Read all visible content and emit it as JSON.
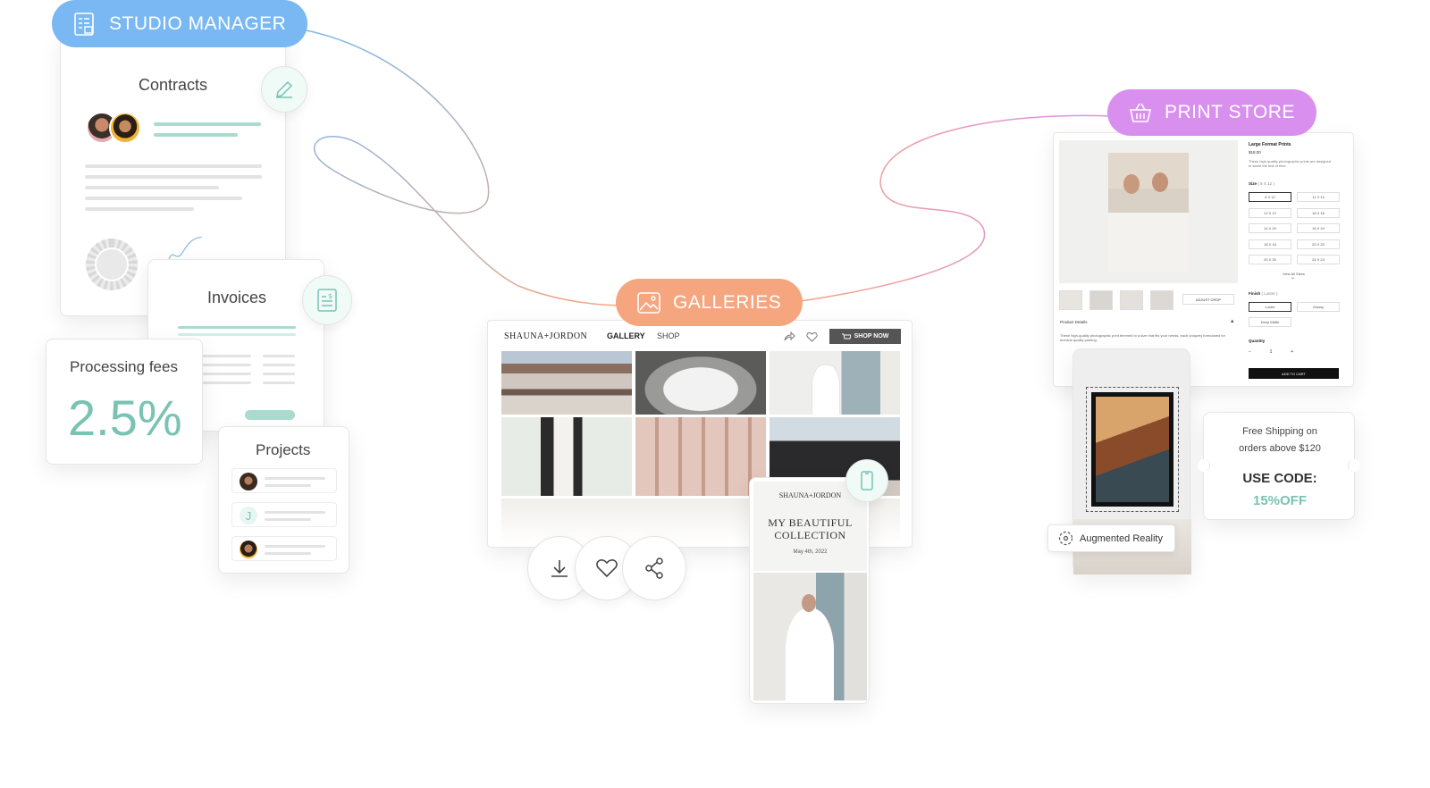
{
  "studio": {
    "label": "STUDIO MANAGER",
    "contracts_title": "Contracts",
    "invoices_title": "Invoices",
    "fees_label": "Processing fees",
    "fees_value": "2.5%",
    "projects_title": "Projects",
    "project_initial": "J"
  },
  "galleries": {
    "label": "GALLERIES",
    "brand": "SHAUNA+JORDON",
    "nav": [
      "GALLERY",
      "SHOP"
    ],
    "shop_button": "SHOP NOW",
    "phone": {
      "brand": "SHAUNA+JORDON",
      "title_line1": "MY BEAUTIFUL",
      "title_line2": "COLLECTION",
      "date": "May 4th, 2022"
    }
  },
  "print_store": {
    "label": "PRINT STORE",
    "product_title": "Large Format Prints",
    "price": "$18.00",
    "description": "These high-quality photographic prints are designed to stand the test of time.",
    "size_label": "Size",
    "size_selected": "( 8 X 12 )",
    "sizes": [
      "8 X 12",
      "11 X 14",
      "12 X 12",
      "16 X 16",
      "14 X 20",
      "16 X 24",
      "18 X 18",
      "20 X 20",
      "20 X 30",
      "24 X 24"
    ],
    "view_all": "View All Sizes",
    "adjust_crop": "ADJUST CROP",
    "finish_label": "Finish",
    "finish_selected": "( Lustre )",
    "finishes": [
      "Lustre",
      "Glossy",
      "Deep Matte"
    ],
    "quantity_label": "Quantity",
    "quantity": "1",
    "add_to_cart": "ADD TO CART",
    "details_label": "Product Details",
    "details_text": "These high-quality photographic print trimmed to a size that fits your needs, each uniquely formulated for archival quality printing.",
    "ar_label": "Augmented Reality",
    "coupon_line1": "Free Shipping on",
    "coupon_line2": "orders above $120",
    "coupon_code_label": "USE CODE:",
    "coupon_code": "15%OFF"
  },
  "colors": {
    "studio": "#79b8f2",
    "galleries": "#f6a67e",
    "print": "#d88fee",
    "teal": "#79c3b3"
  }
}
